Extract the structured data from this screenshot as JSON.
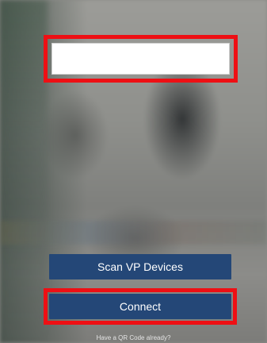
{
  "device_input": {
    "value": "",
    "placeholder": ""
  },
  "buttons": {
    "scan_label": "Scan VP Devices",
    "connect_label": "Connect"
  },
  "qr_link_text": "Have a QR Code already?",
  "colors": {
    "button_bg": "#244777",
    "highlight": "#ee0f14",
    "input_bg": "#ffffff"
  }
}
